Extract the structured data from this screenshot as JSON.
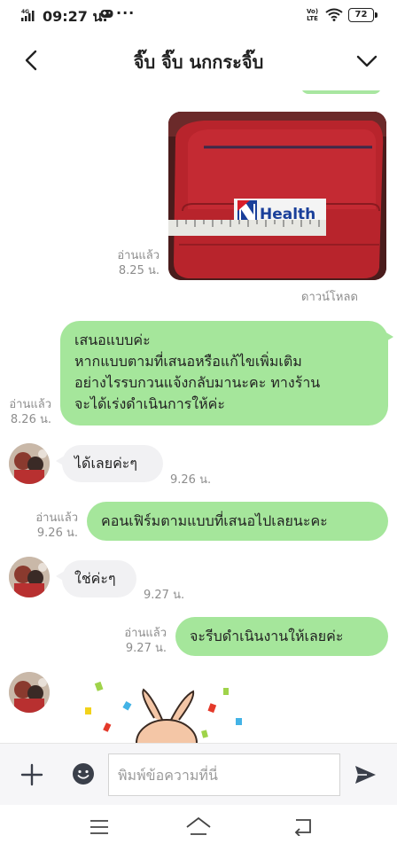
{
  "status_bar": {
    "time": "09:27 น.",
    "network": "4G",
    "volte": "VoLTE",
    "battery": "72",
    "more": "···"
  },
  "header": {
    "title": "จิ๊บ จิ๊บ นกกระจิ๊บ"
  },
  "messages": {
    "image_msg": {
      "read_label": "อ่านแล้ว",
      "time": "8.25 น.",
      "download_label": "ดาวน์โหลด",
      "image_text": "Health"
    },
    "outgoing_1": {
      "lines": [
        "เสนอแบบค่ะ",
        "หากแบบตามที่เสนอหรือแก้ไขเพิ่มเติม",
        "อย่างไรรบกวนแจ้งกลับมานะคะ ทางร้าน",
        "จะได้เร่งดำเนินการให้ค่ะ"
      ],
      "read_label": "อ่านแล้ว",
      "time": "8.26 น."
    },
    "incoming_1": {
      "text": "ได้เลยค่ะๆ",
      "time": "9.26 น."
    },
    "outgoing_2": {
      "text": "คอนเฟิร์มตามแบบที่เสนอไปเลยนะคะ",
      "read_label": "อ่านแล้ว",
      "time": "9.26 น."
    },
    "incoming_2": {
      "text": "ใช่ค่ะๆ",
      "time": "9.27 น."
    },
    "outgoing_3": {
      "text": "จะรีบดำเนินงานให้เลยค่ะ",
      "read_label": "อ่านแล้ว",
      "time": "9.27 น."
    }
  },
  "input_bar": {
    "placeholder": "พิมพ์ข้อความที่นี่",
    "value": ""
  },
  "colors": {
    "outgoing_bubble": "#a5e69b",
    "incoming_bubble": "#f1f1f3",
    "meta_text": "#8d8d8d"
  },
  "icons": [
    "back-icon",
    "chevron-down-icon",
    "plus-icon",
    "emoji-icon",
    "send-icon",
    "nav-menu-icon",
    "nav-home-icon",
    "nav-back-icon"
  ]
}
